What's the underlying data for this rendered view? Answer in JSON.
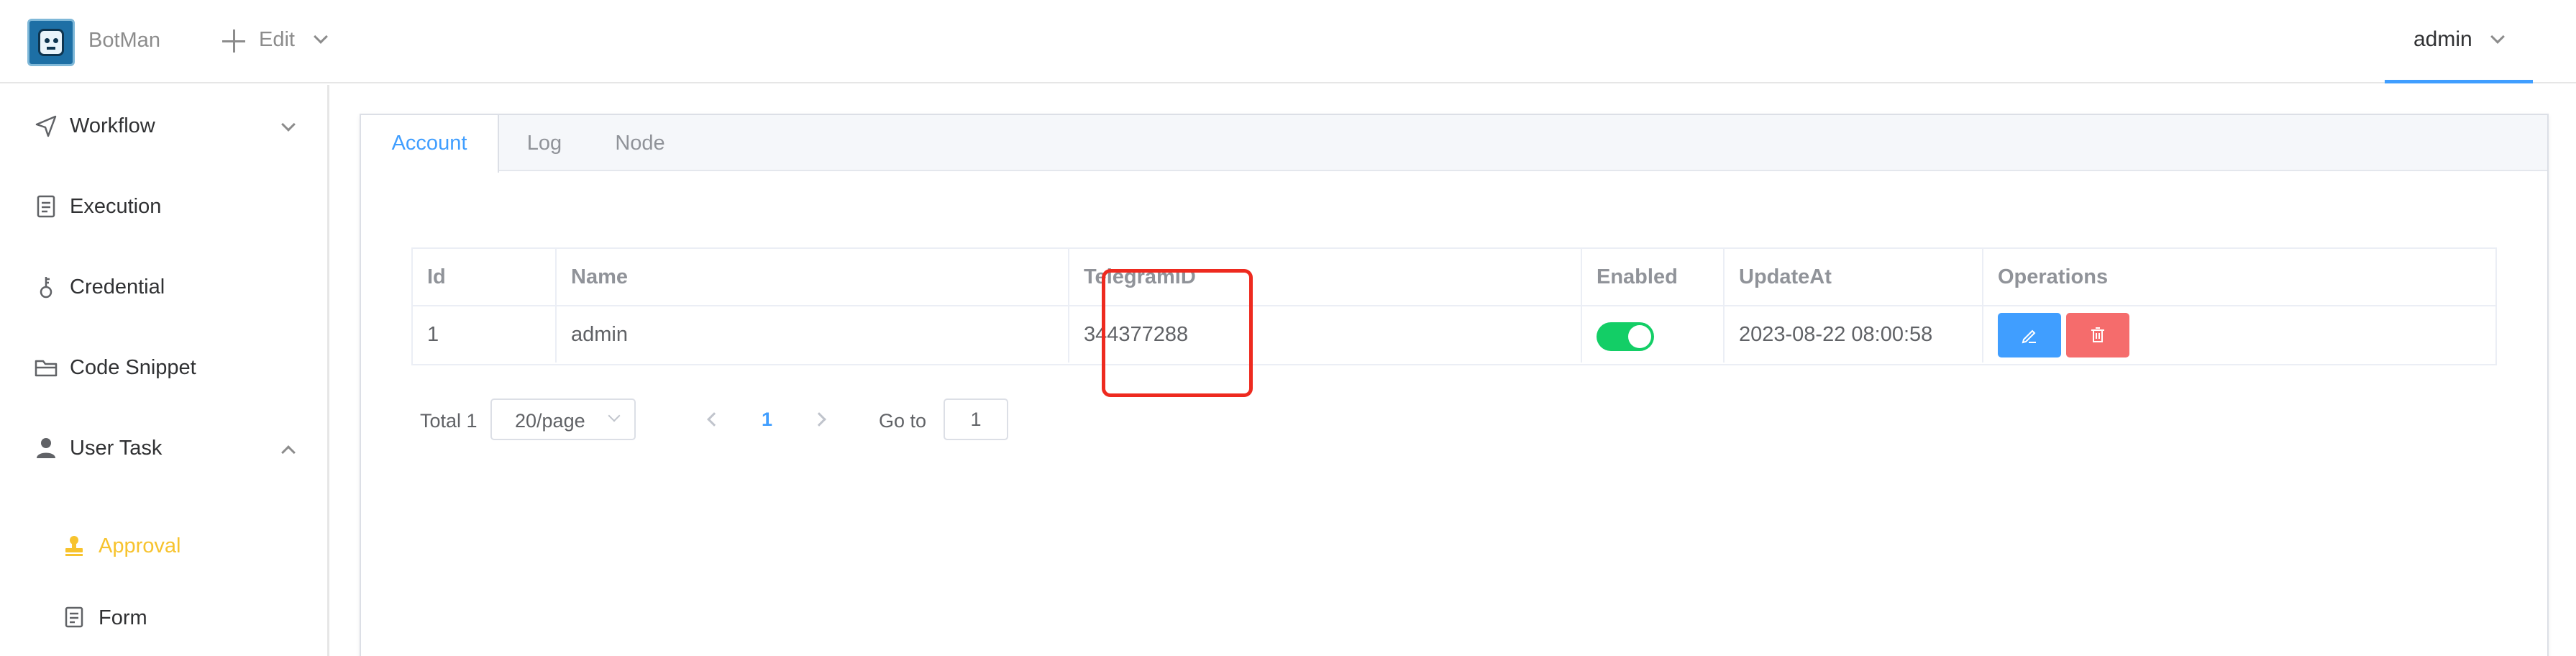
{
  "header": {
    "app_name": "BotMan",
    "edit_label": "Edit",
    "user_name": "admin"
  },
  "sidebar": {
    "items": [
      {
        "label": "Workflow",
        "icon": "navigation-icon",
        "expandable": true,
        "expanded": false
      },
      {
        "label": "Execution",
        "icon": "document-icon"
      },
      {
        "label": "Credential",
        "icon": "key-icon"
      },
      {
        "label": "Code Snippet",
        "icon": "folder-icon"
      },
      {
        "label": "User Task",
        "icon": "user-icon",
        "expandable": true,
        "expanded": true
      }
    ],
    "sub_items": [
      {
        "label": "Approval",
        "icon": "stamp-icon",
        "active": true
      },
      {
        "label": "Form",
        "icon": "form-icon"
      }
    ]
  },
  "tabs": [
    {
      "label": "Account",
      "active": true
    },
    {
      "label": "Log"
    },
    {
      "label": "Node"
    }
  ],
  "table": {
    "columns": [
      "Id",
      "Name",
      "TelegramID",
      "Enabled",
      "UpdateAt",
      "Operations"
    ],
    "rows": [
      {
        "id": "1",
        "name": "admin",
        "telegram_id": "344377288",
        "enabled": true,
        "update_at": "2023-08-22 08:00:58"
      }
    ]
  },
  "pagination": {
    "total": "Total 1",
    "page_size": "20/page",
    "current_page": "1",
    "goto_label": "Go to",
    "goto_value": "1"
  },
  "colors": {
    "accent": "#409eff",
    "active_sub": "#f7c32e",
    "switch_on": "#13ce66",
    "danger": "#f56c6c",
    "highlight": "#ee2a1f"
  }
}
